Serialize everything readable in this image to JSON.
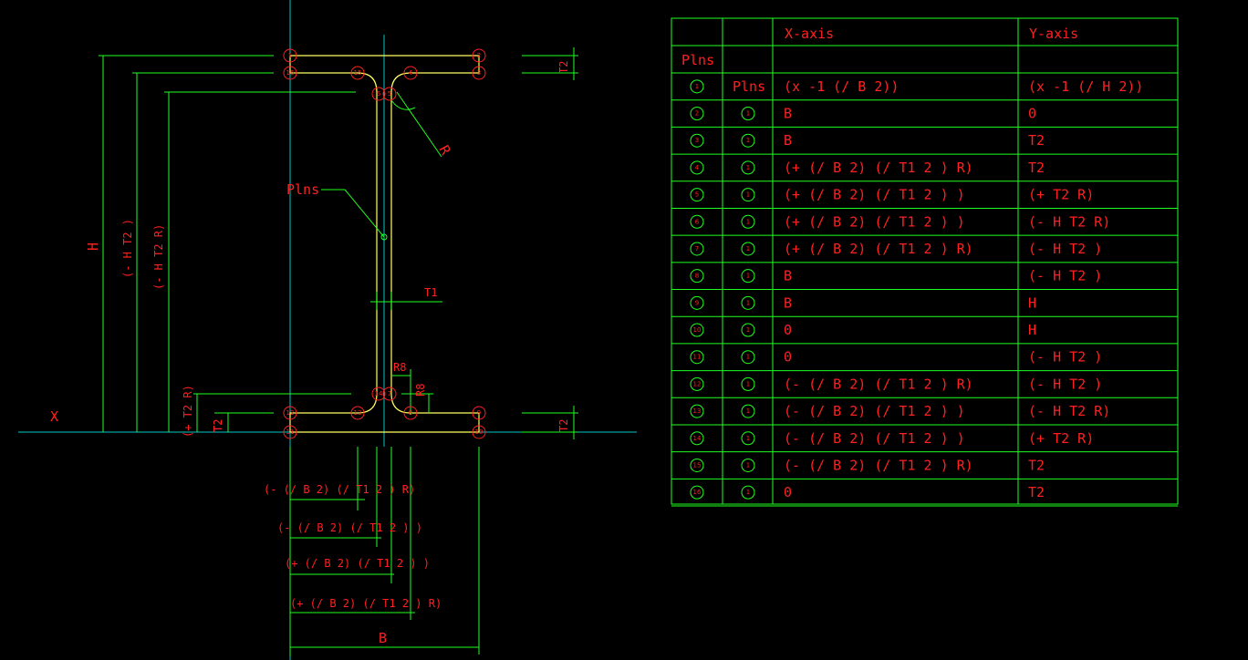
{
  "drawing": {
    "axis_label": "X",
    "pins_label": "Plns",
    "dim_r": "R",
    "dim_t1": "T1",
    "dim_r8": "R8",
    "dim_r8_vert": "R8",
    "dim_h": "H",
    "dim_h_t2": "(- H T2 )",
    "dim_h_t2_r": "(- H T2 R)",
    "dim_t2_r": "(+ T2 R)",
    "dim_t2_left": "T2",
    "dim_t2_right_top": "T2",
    "dim_t2_right_bot": "T2",
    "dim_b1": "(- (/ B 2) (/ T1 2 ) R)",
    "dim_b2": "(- (/ B 2) (/ T1 2 ) )",
    "dim_b3": "(+ (/ B 2) (/ T1 2 ) )",
    "dim_b4": "(+ (/ B 2) (/ T1 2 ) R)",
    "dim_b": "B",
    "point_numbers": [
      "1",
      "2",
      "3",
      "4",
      "5",
      "6",
      "7",
      "8",
      "9",
      "10",
      "11",
      "12",
      "13",
      "14",
      "15",
      "16"
    ]
  },
  "table": {
    "header": [
      "",
      "",
      "X-axis",
      "Y-axis"
    ],
    "subheader": "Plns",
    "rows": [
      {
        "n": "1",
        "pin": "Plns",
        "x": "(x -1 (/ B 2))",
        "y": "(x -1 (/ H 2))"
      },
      {
        "n": "2",
        "pin": "1",
        "x": "B",
        "y": "0"
      },
      {
        "n": "3",
        "pin": "1",
        "x": "B",
        "y": "T2"
      },
      {
        "n": "4",
        "pin": "1",
        "x": "(+ (/ B 2) (/ T1 2 ) R)",
        "y": "T2"
      },
      {
        "n": "5",
        "pin": "1",
        "x": "(+ (/ B 2) (/ T1 2 ) )",
        "y": "(+ T2 R)"
      },
      {
        "n": "6",
        "pin": "1",
        "x": "(+ (/ B 2) (/ T1 2 ) )",
        "y": "(- H T2 R)"
      },
      {
        "n": "7",
        "pin": "1",
        "x": "(+ (/ B 2) (/ T1 2 ) R)",
        "y": "(- H T2 )"
      },
      {
        "n": "8",
        "pin": "1",
        "x": "B",
        "y": "(- H T2 )"
      },
      {
        "n": "9",
        "pin": "1",
        "x": "B",
        "y": "H"
      },
      {
        "n": "10",
        "pin": "1",
        "x": "0",
        "y": "H"
      },
      {
        "n": "11",
        "pin": "1",
        "x": "0",
        "y": "(- H T2 )"
      },
      {
        "n": "12",
        "pin": "1",
        "x": "(- (/ B 2) (/ T1 2 ) R)",
        "y": "(- H T2 )"
      },
      {
        "n": "13",
        "pin": "1",
        "x": "(- (/ B 2) (/ T1 2 ) )",
        "y": "(- H T2 R)"
      },
      {
        "n": "14",
        "pin": "1",
        "x": "(- (/ B 2) (/ T1 2 ) )",
        "y": "(+ T2 R)"
      },
      {
        "n": "15",
        "pin": "1",
        "x": "(- (/ B 2) (/ T1 2 ) R)",
        "y": "T2"
      },
      {
        "n": "16",
        "pin": "1",
        "x": "0",
        "y": "T2"
      }
    ]
  },
  "colors": {
    "background": "#000000",
    "dimension": "#20ff20",
    "text": "#ff2020",
    "centerline": "#00c8c8",
    "profile": "#ffff60"
  }
}
